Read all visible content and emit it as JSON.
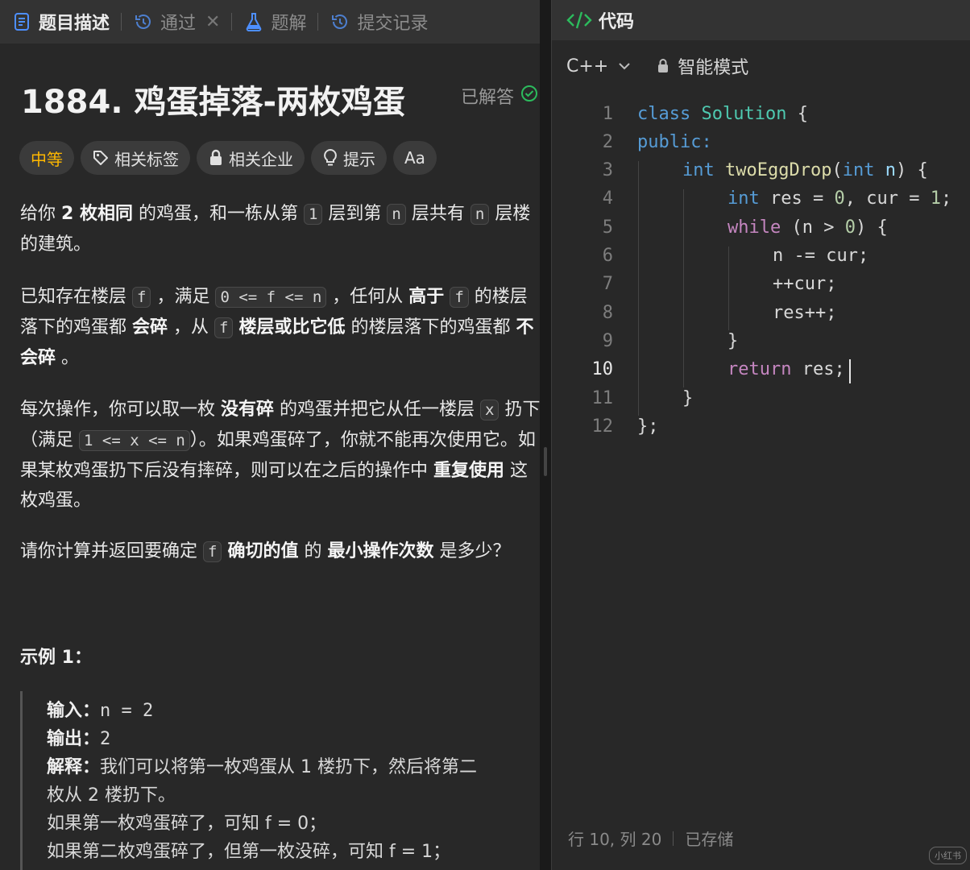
{
  "left_tabs": [
    {
      "label": "题目描述",
      "icon": "description-icon"
    },
    {
      "label": "通过",
      "icon": "history-icon",
      "close": "✕"
    },
    {
      "label": "题解",
      "icon": "flask-icon"
    },
    {
      "label": "提交记录",
      "icon": "history-icon"
    }
  ],
  "problem": {
    "title": "1884. 鸡蛋掉落-两枚鸡蛋",
    "status": "已解答"
  },
  "tags": {
    "difficulty": "中等",
    "related_tags": "相关标签",
    "related_companies": "相关企业",
    "hint": "提示",
    "font_toggle": "Aa"
  },
  "description": {
    "p1": {
      "t1": "给你 ",
      "b1": "2 枚相同",
      "t2": " 的鸡蛋，和一栋从第 ",
      "c1": "1",
      "t3": " 层到第 ",
      "c2": "n",
      "t4": " 层共有 ",
      "c3": "n",
      "t5": " 层楼的建筑。"
    },
    "p2": {
      "t1": "已知存在楼层 ",
      "c1": "f",
      "t2": " ，满足 ",
      "c2": "0 <= f <= n",
      "t3": " ，任何从 ",
      "b1": "高于",
      "t4": " ",
      "c3": "f",
      "t5": " 的楼层落下的鸡蛋都 ",
      "b2": "会碎",
      "t6": " ，从 ",
      "c4": "f",
      "t7": " ",
      "b3": "楼层或比它低",
      "t8": " 的楼层落下的鸡蛋都 ",
      "b4": "不会碎",
      "t9": " 。"
    },
    "p3": {
      "t1": "每次操作，你可以取一枚 ",
      "b1": "没有碎",
      "t2": " 的鸡蛋并把它从任一楼层 ",
      "c1": "x",
      "t3": " 扔下（满足 ",
      "c2": "1 <= x <= n",
      "t4": "）。如果鸡蛋碎了，你就不能再次使用它。如果某枚鸡蛋扔下后没有摔碎，则可以在之后的操作中 ",
      "b2": "重复使用",
      "t5": " 这枚鸡蛋。"
    },
    "p4": {
      "t1": "请你计算并返回要确定 ",
      "c1": "f",
      "t2": " ",
      "b1": "确切的值",
      "t3": " 的 ",
      "b2": "最小操作次数",
      "t4": " 是多少？"
    }
  },
  "example": {
    "title": "示例 1：",
    "input_label": "输入：",
    "input_value": "n = 2",
    "output_label": "输出：",
    "output_value": "2",
    "explain_label": "解释：",
    "explain_lines": [
      "我们可以将第一枚鸡蛋从  1  楼扔下，然后将第二",
      "枚从  2  楼扔下。",
      "如果第一枚鸡蛋碎了，可知  f  =  0；",
      "如果第二枚鸡蛋碎了，但第一枚没碎，可知  f  =  1；"
    ]
  },
  "editor": {
    "title": "代码",
    "language": "C++",
    "mode": "智能模式",
    "line_numbers": [
      "1",
      "2",
      "3",
      "4",
      "5",
      "6",
      "7",
      "8",
      "9",
      "10",
      "11",
      "12"
    ],
    "current_line": "10",
    "code": {
      "l1_kw": "class",
      "l1_sp": " ",
      "l1_name": "Solution",
      "l1_rest": " {",
      "l2": "public:",
      "l3_type": "int",
      "l3_fn": "twoEggDrop",
      "l3_p1": "(",
      "l3_ptype": "int",
      "l3_pname": " n",
      "l3_p2": ") {",
      "l4_type": "int",
      "l4_a": " res = ",
      "l4_n1": "0",
      "l4_b": ", cur = ",
      "l4_n2": "1",
      "l4_c": ";",
      "l5_kw": "while",
      "l5_a": " (n > ",
      "l5_n": "0",
      "l5_b": ") {",
      "l6": "n -= cur;",
      "l7": "++cur;",
      "l8": "res++;",
      "l9": "}",
      "l10_kw": "return",
      "l10_rest": " res;",
      "l11": "}",
      "l12": "};"
    }
  },
  "status_bar": {
    "position": "行 10, 列 20",
    "saved": "已存储"
  },
  "watermark": "小红书"
}
